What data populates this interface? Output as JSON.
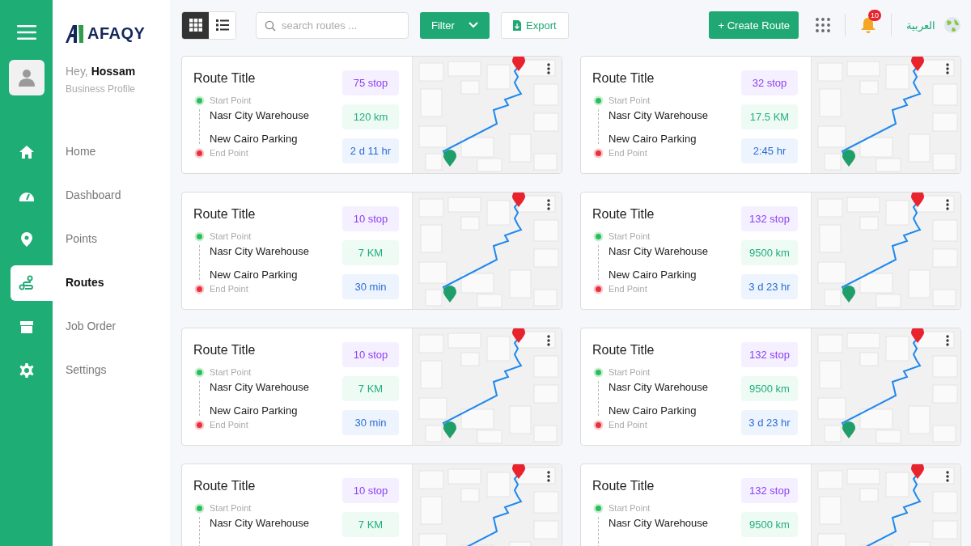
{
  "logo": "AFAQY",
  "profile": {
    "greeting": "Hey,",
    "name": "Hossam",
    "subtitle": "Business Profile"
  },
  "sidebar": {
    "items": [
      {
        "label": "Home",
        "kind": "home",
        "selected": false
      },
      {
        "label": "Dashboard",
        "kind": "gauge",
        "selected": false
      },
      {
        "label": "Points",
        "kind": "pin",
        "selected": false
      },
      {
        "label": "Routes",
        "kind": "route",
        "selected": true
      },
      {
        "label": "Job Order",
        "kind": "box",
        "selected": false
      },
      {
        "label": "Settings",
        "kind": "gear",
        "selected": false
      }
    ]
  },
  "toolbar": {
    "view_modes": [
      {
        "kind": "grid",
        "selected": true
      },
      {
        "kind": "list",
        "selected": false
      }
    ],
    "search": {
      "placeholder": "search routes ..."
    },
    "filter": "Filter",
    "export": "Export",
    "create": "+ Create Route",
    "notifications": "10",
    "language": "العربية"
  },
  "routes": [
    {
      "title": "Route Title",
      "stops": "75 stop",
      "start_label": "Start Point",
      "start": "Nasr City Warehouse",
      "distance": "120 km",
      "end": "New Cairo Parking",
      "end_label": "End Point",
      "duration": "2 d 11 hr"
    },
    {
      "title": "Route Title",
      "stops": "32 stop",
      "start_label": "Start Point",
      "start": "Nasr City Warehouse",
      "distance": "17.5 KM",
      "end": "New Cairo Parking",
      "end_label": "End Point",
      "duration": "2:45 hr"
    },
    {
      "title": "Route Title",
      "stops": "10 stop",
      "start_label": "Start Point",
      "start": "Nasr City Warehouse",
      "distance": "7 KM",
      "end": "New Cairo Parking",
      "end_label": "End Point",
      "duration": "30 min"
    },
    {
      "title": "Route Title",
      "stops": "132 stop",
      "start_label": "Start Point",
      "start": "Nasr City Warehouse",
      "distance": "9500 km",
      "end": "New Cairo Parking",
      "end_label": "End Point",
      "duration": "3 d 23 hr"
    },
    {
      "title": "Route Title",
      "stops": "10 stop",
      "start_label": "Start Point",
      "start": "Nasr City Warehouse",
      "distance": "7 KM",
      "end": "New Cairo Parking",
      "end_label": "End Point",
      "duration": "30 min"
    },
    {
      "title": "Route Title",
      "stops": "132 stop",
      "start_label": "Start Point",
      "start": "Nasr City Warehouse",
      "distance": "9500 km",
      "end": "New Cairo Parking",
      "end_label": "End Point",
      "duration": "3 d 23 hr"
    },
    {
      "title": "Route Title",
      "stops": "10 stop",
      "start_label": "Start Point",
      "start": "Nasr City Warehouse",
      "distance": "7 KM"
    },
    {
      "title": "Route Title",
      "stops": "132 stop",
      "start_label": "Start Point",
      "start": "Nasr City Warehouse",
      "distance": "9500 km"
    }
  ]
}
